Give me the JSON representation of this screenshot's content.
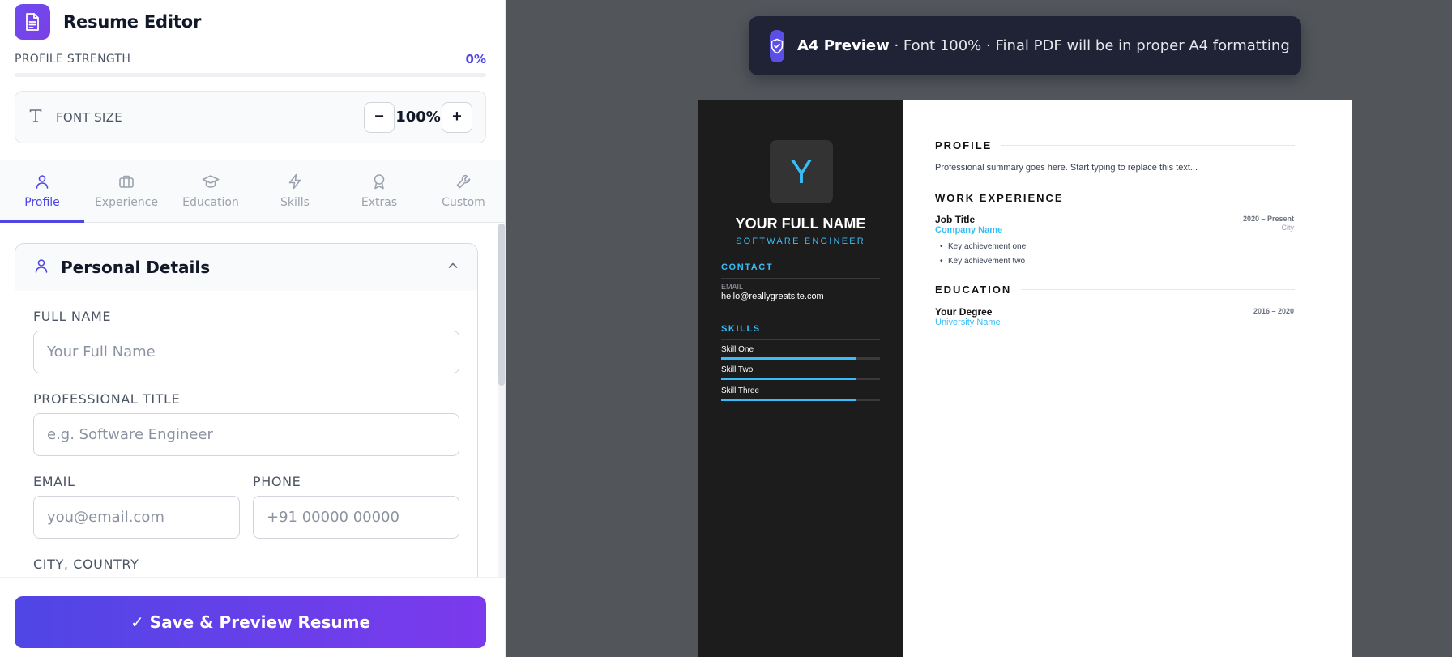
{
  "editor": {
    "app_title": "Resume Editor",
    "profile_strength": {
      "label": "PROFILE STRENGTH",
      "value": "0%",
      "progress_fraction": 0
    },
    "font_size": {
      "label": "FONT SIZE",
      "value": "100%",
      "decrease": "−",
      "increase": "+"
    },
    "tabs": [
      {
        "label": "Profile",
        "icon": "user-icon",
        "active": true
      },
      {
        "label": "Experience",
        "icon": "briefcase-icon",
        "active": false
      },
      {
        "label": "Education",
        "icon": "graduation-cap-icon",
        "active": false
      },
      {
        "label": "Skills",
        "icon": "lightning-icon",
        "active": false
      },
      {
        "label": "Extras",
        "icon": "award-icon",
        "active": false
      },
      {
        "label": "Custom",
        "icon": "wrench-icon",
        "active": false
      }
    ],
    "section": {
      "title": "Personal Details",
      "fields": {
        "full_name": {
          "label": "FULL NAME",
          "placeholder": "Your Full Name",
          "value": ""
        },
        "professional_title": {
          "label": "PROFESSIONAL TITLE",
          "placeholder": "e.g. Software Engineer",
          "value": ""
        },
        "email": {
          "label": "EMAIL",
          "placeholder": "you@email.com",
          "value": ""
        },
        "phone": {
          "label": "PHONE",
          "placeholder": "+91 00000 00000",
          "value": ""
        },
        "city_country": {
          "label": "CITY, COUNTRY",
          "placeholder": "",
          "value": ""
        }
      }
    },
    "save_button": "✓ Save & Preview Resume"
  },
  "preview": {
    "banner": {
      "strong": "A4 Preview",
      "rest": " · Font 100% · Final PDF will be in proper A4 formatting"
    },
    "resume": {
      "initial": "Y",
      "name": "YOUR FULL NAME",
      "title": "SOFTWARE ENGINEER",
      "contact_heading": "CONTACT",
      "email_label": "EMAIL",
      "email": "hello@reallygreatsite.com",
      "skills_heading": "SKILLS",
      "skills": [
        {
          "name": "Skill One",
          "level": 0.85
        },
        {
          "name": "Skill Two",
          "level": 0.85
        },
        {
          "name": "Skill Three",
          "level": 0.85
        }
      ],
      "profile_heading": "PROFILE",
      "summary": "Professional summary goes here. Start typing to replace this text...",
      "work_heading": "WORK EXPERIENCE",
      "job": {
        "title": "Job Title",
        "company": "Company Name",
        "dates": "2020 – Present",
        "city": "City",
        "bullets": [
          "Key achievement one",
          "Key achievement two"
        ]
      },
      "education_heading": "EDUCATION",
      "education": {
        "degree": "Your Degree",
        "school": "University Name",
        "dates": "2016 – 2020"
      }
    }
  },
  "colors": {
    "accent": "#4f46e5",
    "accent_purple": "#7c3aed",
    "resume_accent": "#38bdf8",
    "sidebar_dark": "#1c1c1c",
    "preview_bg": "#52565b"
  }
}
